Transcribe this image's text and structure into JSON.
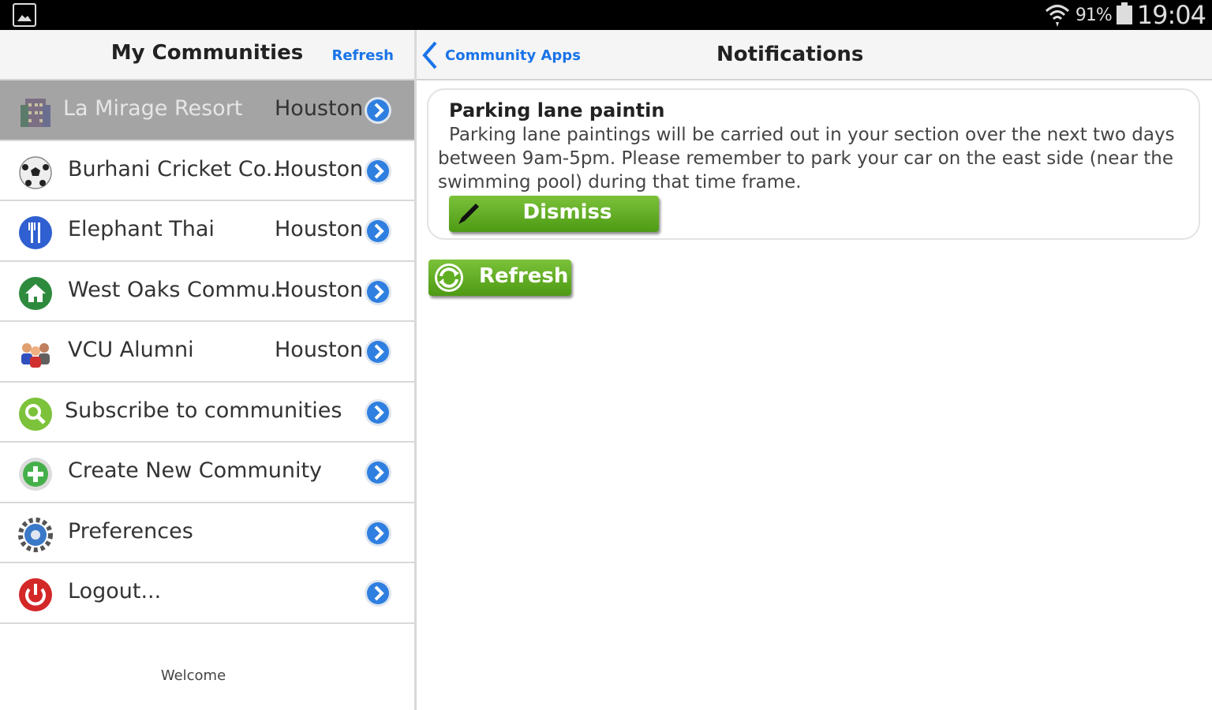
{
  "status_bar": {
    "battery_pct": "91%",
    "time": "19:04"
  },
  "left": {
    "title": "My Communities",
    "refresh_label": "Refresh",
    "items": [
      {
        "label": "La Mirage Resort",
        "city": "Houston",
        "icon": "building-icon",
        "selected": true
      },
      {
        "label": "Burhani Cricket Co...",
        "city": "Houston",
        "icon": "soccer-ball-icon"
      },
      {
        "label": "Elephant Thai",
        "city": "Houston",
        "icon": "restaurant-icon"
      },
      {
        "label": "West Oaks Commu...",
        "city": "Houston",
        "icon": "home-icon"
      },
      {
        "label": "VCU Alumni",
        "city": "Houston",
        "icon": "people-icon"
      },
      {
        "label": "Subscribe to communities",
        "icon": "search-icon"
      },
      {
        "label": "Create New Community",
        "icon": "add-icon"
      },
      {
        "label": "Preferences",
        "icon": "gear-icon"
      },
      {
        "label": "Logout...",
        "icon": "power-icon"
      }
    ],
    "welcome": "Welcome"
  },
  "right": {
    "back_label": "Community Apps",
    "title": "Notifications",
    "notification": {
      "title": "Parking lane paintin",
      "body": "Parking lane paintings will be carried out in your section over the next two days between 9am-5pm. Please remember to park your car on the east side (near the swimming pool) during that time frame.",
      "dismiss_label": "Dismiss"
    },
    "refresh_label": "Refresh"
  },
  "colors": {
    "accent_blue": "#1a73e8",
    "button_green": "#5fae22",
    "selected_row": "#a4a4a4"
  }
}
